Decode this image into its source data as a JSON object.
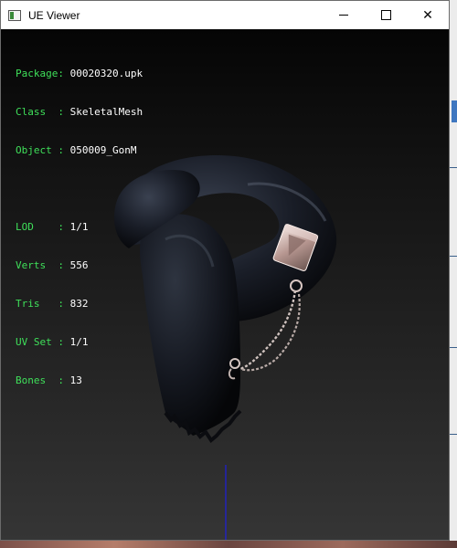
{
  "window": {
    "title": "UE Viewer",
    "controls": {
      "minimize": "minimize",
      "maximize": "maximize",
      "close": "✕"
    }
  },
  "info": {
    "package": {
      "label": "Package:",
      "value": "00020320.upk"
    },
    "class": {
      "label": "Class  :",
      "value": "SkeletalMesh"
    },
    "object": {
      "label": "Object :",
      "value": "050009_GonM"
    },
    "lod": {
      "label": "LOD    :",
      "value": "1/1"
    },
    "verts": {
      "label": "Verts  :",
      "value": "556"
    },
    "tris": {
      "label": "Tris   :",
      "value": "832"
    },
    "uvset": {
      "label": "UV Set :",
      "value": "1/1"
    },
    "bones": {
      "label": "Bones  :",
      "value": "13"
    }
  },
  "colors": {
    "label_green": "#3fe05a",
    "value_white": "#ffffff",
    "axis_blue": "#1a1aff",
    "mesh_dark": "#1b1f2a"
  },
  "icons": {
    "app": "app-window-icon",
    "minimize": "minimize-icon",
    "maximize": "maximize-icon",
    "close": "close-icon"
  }
}
